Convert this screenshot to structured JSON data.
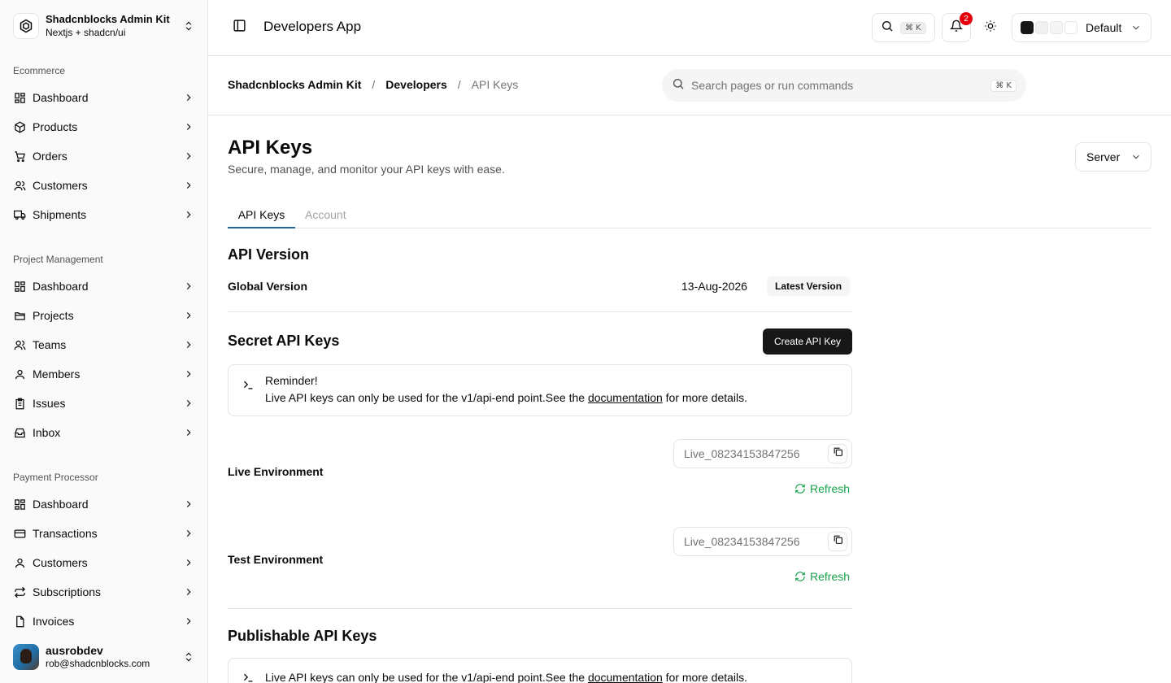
{
  "team": {
    "name": "Shadcnblocks Admin Kit",
    "subtitle": "Nextjs + shadcn/ui"
  },
  "sidebar": {
    "groups": [
      {
        "label": "Ecommerce",
        "items": [
          {
            "label": "Dashboard",
            "icon": "dashboard-icon"
          },
          {
            "label": "Products",
            "icon": "package-icon"
          },
          {
            "label": "Orders",
            "icon": "cart-icon"
          },
          {
            "label": "Customers",
            "icon": "users-icon"
          },
          {
            "label": "Shipments",
            "icon": "truck-icon"
          }
        ]
      },
      {
        "label": "Project Management",
        "items": [
          {
            "label": "Dashboard",
            "icon": "dashboard-icon"
          },
          {
            "label": "Projects",
            "icon": "folder-icon"
          },
          {
            "label": "Teams",
            "icon": "users-icon"
          },
          {
            "label": "Members",
            "icon": "user-icon"
          },
          {
            "label": "Issues",
            "icon": "clipboard-icon"
          },
          {
            "label": "Inbox",
            "icon": "inbox-icon"
          }
        ]
      },
      {
        "label": "Payment Processor",
        "items": [
          {
            "label": "Dashboard",
            "icon": "dashboard-icon"
          },
          {
            "label": "Transactions",
            "icon": "credit-card-icon"
          },
          {
            "label": "Customers",
            "icon": "user-icon"
          },
          {
            "label": "Subscriptions",
            "icon": "repeat-icon"
          },
          {
            "label": "Invoices",
            "icon": "file-icon"
          }
        ]
      }
    ]
  },
  "user": {
    "name": "ausrobdev",
    "email": "rob@shadcnblocks.com"
  },
  "topbar": {
    "title": "Developers App",
    "search_kbd": "⌘ K",
    "notification_count": "2",
    "theme_label": "Default",
    "theme_swatches": [
      "#171717",
      "#f0f0f0",
      "#f5f5f5",
      "#ffffff"
    ]
  },
  "breadcrumb": {
    "items": [
      "Shadcnblocks Admin Kit",
      "Developers"
    ],
    "current": "API Keys",
    "separator": "/"
  },
  "command_search": {
    "placeholder": "Search pages or run commands",
    "kbd": "⌘ K"
  },
  "page": {
    "title": "API Keys",
    "subtitle": "Secure, manage, and monitor your API keys with ease.",
    "environment_select": "Server",
    "tabs": [
      "API Keys",
      "Account"
    ]
  },
  "api_version": {
    "heading": "API Version",
    "label": "Global Version",
    "date": "13-Aug-2026",
    "badge": "Latest Version"
  },
  "secret_keys": {
    "heading": "Secret API Keys",
    "create_label": "Create API Key",
    "reminder_title": "Reminder!",
    "reminder_text": "Live API keys can only be used for the v1/api-end point.See the",
    "reminder_link": "documentation",
    "reminder_suffix": "for more details.",
    "live_label": "Live Environment",
    "live_key": "Live_08234153847256",
    "test_label": "Test Environment",
    "test_key": "Live_08234153847256",
    "refresh_label": "Refresh"
  },
  "publishable_keys": {
    "heading": "Publishable API Keys",
    "reminder_text": "Live API keys can only be used for the v1/api-end point.See the",
    "reminder_link": "documentation",
    "reminder_suffix": "for more details."
  },
  "colors": {
    "accent": "#1f6aa0",
    "success": "#16a34a",
    "badge": "#e7000b"
  }
}
